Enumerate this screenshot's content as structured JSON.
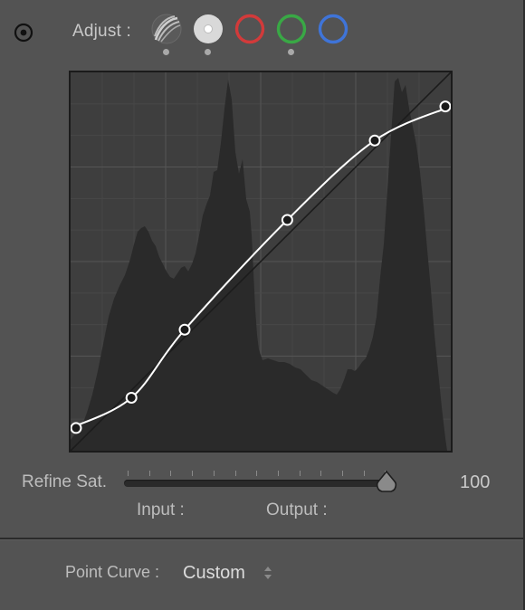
{
  "adjust": {
    "label": "Adjust :",
    "channels": [
      {
        "name": "parametric",
        "selected": false,
        "has_dot": true
      },
      {
        "name": "rgb",
        "selected": true,
        "has_dot": true
      },
      {
        "name": "red",
        "color": "#d23a3a",
        "has_dot": false
      },
      {
        "name": "green",
        "color": "#39a845",
        "has_dot": true
      },
      {
        "name": "blue",
        "color": "#3f74d8",
        "has_dot": false
      }
    ]
  },
  "curve": {
    "points": [
      {
        "input": 0,
        "output": 6
      },
      {
        "input": 16,
        "output": 14
      },
      {
        "input": 30,
        "output": 32
      },
      {
        "input": 57,
        "output": 61
      },
      {
        "input": 80,
        "output": 82
      },
      {
        "input": 100,
        "output": 91
      }
    ]
  },
  "refine": {
    "label": "Refine Sat.",
    "value": "100",
    "level": 1.0
  },
  "readout": {
    "input_label": "Input :",
    "output_label": "Output :"
  },
  "point_curve": {
    "label": "Point Curve :",
    "value": "Custom"
  },
  "colors": {
    "panel_bg": "#535353",
    "curve_bg": "#3e3e3e",
    "histogram": "#2a2a2a",
    "curve_line": "#ffffff"
  }
}
